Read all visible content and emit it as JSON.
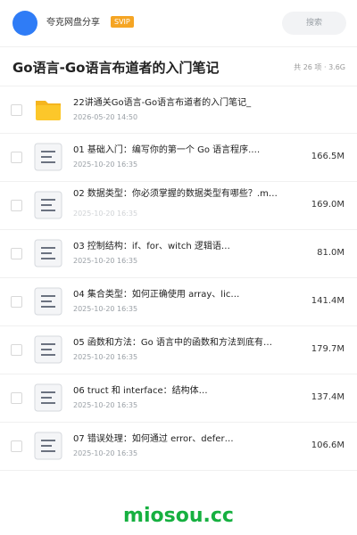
{
  "header": {
    "account_name": "夸克网盘分享",
    "badge": "SVIP",
    "search_placeholder": "搜索"
  },
  "folder": {
    "title": "Go语言-Go语言布道者的入门笔记",
    "meta": "共 26 项 · 3.6G"
  },
  "files": [
    {
      "type": "folder",
      "name": "22讲通关Go语言-Go语言布道者的入门笔记_",
      "date": "2026-05-20 14:50",
      "size": ""
    },
    {
      "type": "doc",
      "name": "01 基础入门：编写你的第一个 Go 语言程序.…",
      "date": "2025-10-20 16:35",
      "size": "166.5M"
    },
    {
      "type": "doc",
      "name": "02 数据类型：你必须掌握的数据类型有哪些？.m…",
      "date": "2025-10-20 16:35",
      "size": "169.0M"
    },
    {
      "type": "doc",
      "name": "03 控制结构：if、for、witch 逻辑语…",
      "date": "2025-10-20 16:35",
      "size": "81.0M"
    },
    {
      "type": "doc",
      "name": "04 集合类型：如何正确使用 array、lic…",
      "date": "2025-10-20 16:35",
      "size": "141.4M"
    },
    {
      "type": "doc",
      "name": "05 函数和方法：Go 语言中的函数和方法到底有…",
      "date": "2025-10-20 16:35",
      "size": "179.7M"
    },
    {
      "type": "doc",
      "name": "06 truct 和 interface：结构体…",
      "date": "2025-10-20 16:35",
      "size": "137.4M"
    },
    {
      "type": "doc",
      "name": "07 错误处理：如何通过 error、defer…",
      "date": "2025-10-20 16:35",
      "size": "106.6M"
    }
  ],
  "watermark": "miosou.cc",
  "colors": {
    "avatar": "#2f7cf6",
    "svip_badge": "#f5a524",
    "folder_icon": "#fcc72a",
    "watermark": "#16b040"
  },
  "icons": {
    "folder": "folder-icon",
    "doc": "document-icon"
  }
}
